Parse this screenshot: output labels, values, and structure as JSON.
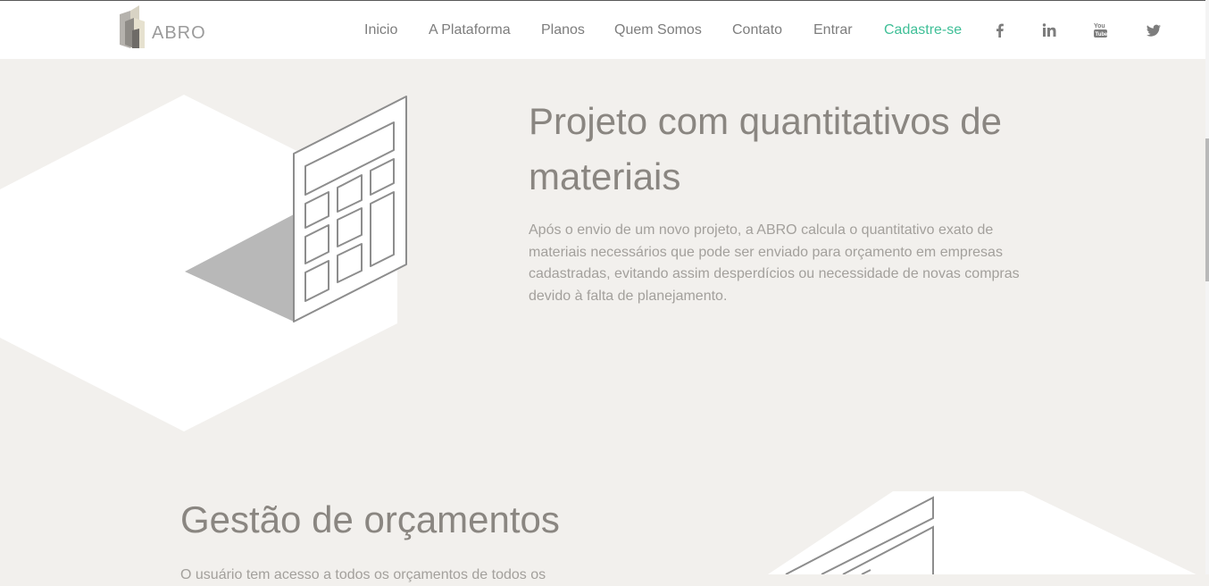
{
  "header": {
    "logo_text": "ABRO",
    "nav": [
      {
        "label": "Inicio"
      },
      {
        "label": "A Plataforma"
      },
      {
        "label": "Planos"
      },
      {
        "label": "Quem Somos"
      },
      {
        "label": "Contato"
      },
      {
        "label": "Entrar"
      },
      {
        "label": "Cadastre-se"
      }
    ],
    "social_icons": [
      "facebook-icon",
      "linkedin-icon",
      "youtube-icon",
      "twitter-icon"
    ],
    "cta_color": "#3fbf97"
  },
  "section_quantitativos": {
    "title": "Projeto com quantitativos de materiais",
    "description": "Após o envio de um novo projeto, a ABRO calcula o quantitativo exato de materiais necessários que pode ser enviado para orçamento em empresas cadastradas, evitando assim desperdícios ou necessidade de novas compras devido à falta de planejamento.",
    "illustration": "calculator-illustration"
  },
  "section_orcamentos": {
    "title": "Gestão de orçamentos",
    "description": "O usuário tem acesso a todos os orçamentos de todos os",
    "illustration": "document-illustration"
  },
  "colors": {
    "background": "#f2f0ed",
    "heading": "#8a8681",
    "body_text": "#a3a09c",
    "nav_text": "#7d7d7d"
  }
}
